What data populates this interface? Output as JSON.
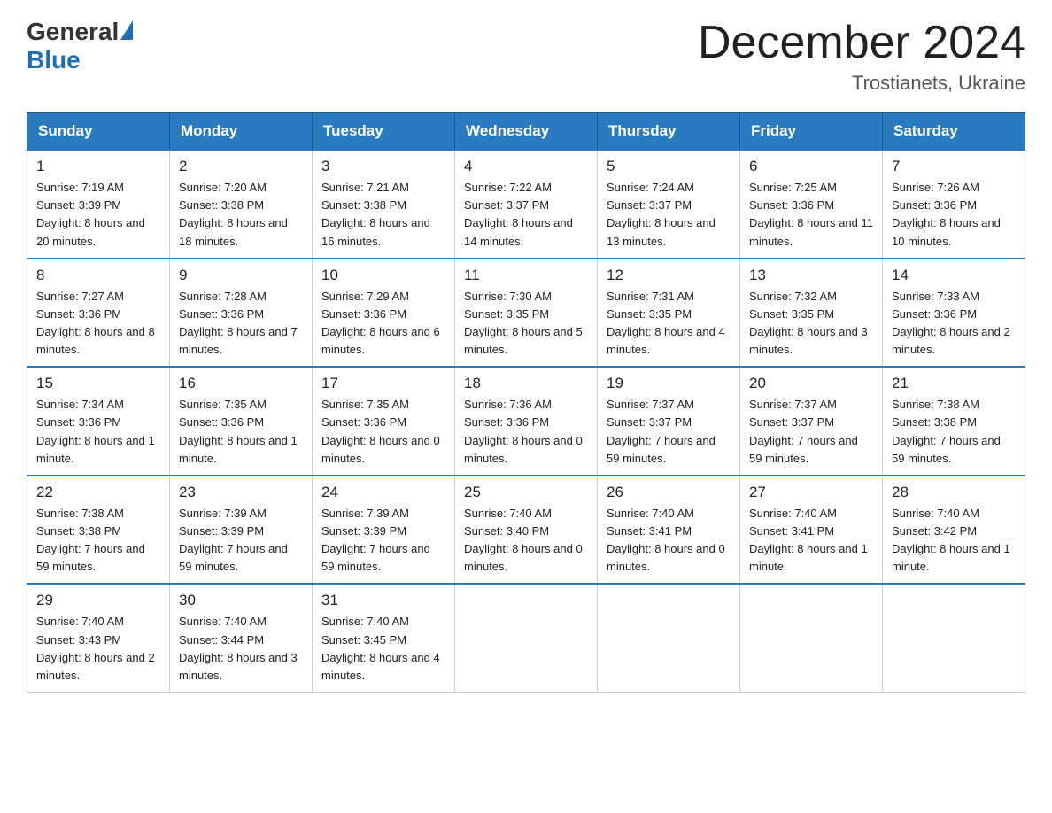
{
  "header": {
    "logo_general": "General",
    "logo_blue": "Blue",
    "month_title": "December 2024",
    "location": "Trostianets, Ukraine"
  },
  "weekdays": [
    "Sunday",
    "Monday",
    "Tuesday",
    "Wednesday",
    "Thursday",
    "Friday",
    "Saturday"
  ],
  "weeks": [
    [
      {
        "day": "1",
        "sunrise": "7:19 AM",
        "sunset": "3:39 PM",
        "daylight": "8 hours and 20 minutes."
      },
      {
        "day": "2",
        "sunrise": "7:20 AM",
        "sunset": "3:38 PM",
        "daylight": "8 hours and 18 minutes."
      },
      {
        "day": "3",
        "sunrise": "7:21 AM",
        "sunset": "3:38 PM",
        "daylight": "8 hours and 16 minutes."
      },
      {
        "day": "4",
        "sunrise": "7:22 AM",
        "sunset": "3:37 PM",
        "daylight": "8 hours and 14 minutes."
      },
      {
        "day": "5",
        "sunrise": "7:24 AM",
        "sunset": "3:37 PM",
        "daylight": "8 hours and 13 minutes."
      },
      {
        "day": "6",
        "sunrise": "7:25 AM",
        "sunset": "3:36 PM",
        "daylight": "8 hours and 11 minutes."
      },
      {
        "day": "7",
        "sunrise": "7:26 AM",
        "sunset": "3:36 PM",
        "daylight": "8 hours and 10 minutes."
      }
    ],
    [
      {
        "day": "8",
        "sunrise": "7:27 AM",
        "sunset": "3:36 PM",
        "daylight": "8 hours and 8 minutes."
      },
      {
        "day": "9",
        "sunrise": "7:28 AM",
        "sunset": "3:36 PM",
        "daylight": "8 hours and 7 minutes."
      },
      {
        "day": "10",
        "sunrise": "7:29 AM",
        "sunset": "3:36 PM",
        "daylight": "8 hours and 6 minutes."
      },
      {
        "day": "11",
        "sunrise": "7:30 AM",
        "sunset": "3:35 PM",
        "daylight": "8 hours and 5 minutes."
      },
      {
        "day": "12",
        "sunrise": "7:31 AM",
        "sunset": "3:35 PM",
        "daylight": "8 hours and 4 minutes."
      },
      {
        "day": "13",
        "sunrise": "7:32 AM",
        "sunset": "3:35 PM",
        "daylight": "8 hours and 3 minutes."
      },
      {
        "day": "14",
        "sunrise": "7:33 AM",
        "sunset": "3:36 PM",
        "daylight": "8 hours and 2 minutes."
      }
    ],
    [
      {
        "day": "15",
        "sunrise": "7:34 AM",
        "sunset": "3:36 PM",
        "daylight": "8 hours and 1 minute."
      },
      {
        "day": "16",
        "sunrise": "7:35 AM",
        "sunset": "3:36 PM",
        "daylight": "8 hours and 1 minute."
      },
      {
        "day": "17",
        "sunrise": "7:35 AM",
        "sunset": "3:36 PM",
        "daylight": "8 hours and 0 minutes."
      },
      {
        "day": "18",
        "sunrise": "7:36 AM",
        "sunset": "3:36 PM",
        "daylight": "8 hours and 0 minutes."
      },
      {
        "day": "19",
        "sunrise": "7:37 AM",
        "sunset": "3:37 PM",
        "daylight": "7 hours and 59 minutes."
      },
      {
        "day": "20",
        "sunrise": "7:37 AM",
        "sunset": "3:37 PM",
        "daylight": "7 hours and 59 minutes."
      },
      {
        "day": "21",
        "sunrise": "7:38 AM",
        "sunset": "3:38 PM",
        "daylight": "7 hours and 59 minutes."
      }
    ],
    [
      {
        "day": "22",
        "sunrise": "7:38 AM",
        "sunset": "3:38 PM",
        "daylight": "7 hours and 59 minutes."
      },
      {
        "day": "23",
        "sunrise": "7:39 AM",
        "sunset": "3:39 PM",
        "daylight": "7 hours and 59 minutes."
      },
      {
        "day": "24",
        "sunrise": "7:39 AM",
        "sunset": "3:39 PM",
        "daylight": "7 hours and 59 minutes."
      },
      {
        "day": "25",
        "sunrise": "7:40 AM",
        "sunset": "3:40 PM",
        "daylight": "8 hours and 0 minutes."
      },
      {
        "day": "26",
        "sunrise": "7:40 AM",
        "sunset": "3:41 PM",
        "daylight": "8 hours and 0 minutes."
      },
      {
        "day": "27",
        "sunrise": "7:40 AM",
        "sunset": "3:41 PM",
        "daylight": "8 hours and 1 minute."
      },
      {
        "day": "28",
        "sunrise": "7:40 AM",
        "sunset": "3:42 PM",
        "daylight": "8 hours and 1 minute."
      }
    ],
    [
      {
        "day": "29",
        "sunrise": "7:40 AM",
        "sunset": "3:43 PM",
        "daylight": "8 hours and 2 minutes."
      },
      {
        "day": "30",
        "sunrise": "7:40 AM",
        "sunset": "3:44 PM",
        "daylight": "8 hours and 3 minutes."
      },
      {
        "day": "31",
        "sunrise": "7:40 AM",
        "sunset": "3:45 PM",
        "daylight": "8 hours and 4 minutes."
      },
      null,
      null,
      null,
      null
    ]
  ]
}
